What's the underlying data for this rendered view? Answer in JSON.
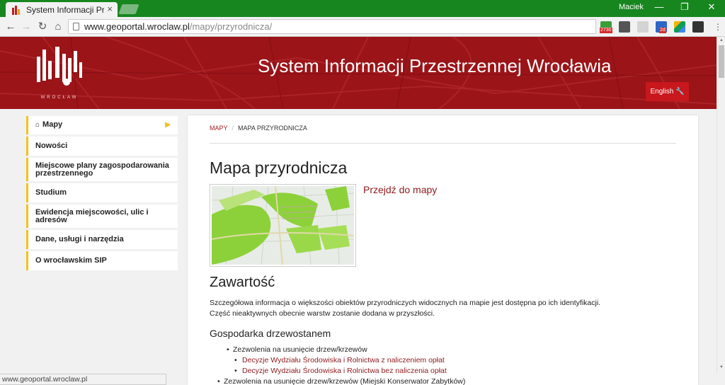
{
  "browser": {
    "tab_title": "System Informacji Przestrzennej Wrocławia",
    "tab_close": "×",
    "user_name": "Maciek",
    "window_minimize": "—",
    "window_restore": "❐",
    "window_close": "✕",
    "back": "←",
    "forward": "→",
    "reload": "↻",
    "home": "⌂",
    "url_domain": "www.geoportal.wroclaw.pl",
    "url_path": "/mapy/przyrodnicza/",
    "ext_badge_1": "2730",
    "ext_badge_2": "2d",
    "status_url": "www.geoportal.wroclaw.pl"
  },
  "banner": {
    "logo_text": "WROCŁAW",
    "site_title": "System Informacji Przestrzennej Wrocławia",
    "english_label": "English 🔧"
  },
  "sidebar": {
    "items": [
      {
        "label": "Mapy"
      },
      {
        "label": "Nowości"
      },
      {
        "label": "Miejscowe plany zagospodarowania przestrzennego"
      },
      {
        "label": "Studium"
      },
      {
        "label": "Ewidencja miejscowości, ulic i adresów"
      },
      {
        "label": "Dane, usługi i narzędzia"
      },
      {
        "label": "O wrocławskim SIP"
      }
    ]
  },
  "main": {
    "breadcrumb": {
      "link": "MAPY",
      "separator": "/",
      "current": "MAPA PRZYRODNICZA"
    },
    "title": "Mapa przyrodnicza",
    "go_to_map": "Przejdź do mapy",
    "section_heading": "Zawartość",
    "para_line1": "Szczegółowa informacja o większości obiektów przyrodniczych widocznych na mapie jest dostępna po ich identyfikacji.",
    "para_line2": "Część nieaktywnych obecnie warstw zostanie dodana w przyszłości.",
    "subheading": "Gospodarka drzewostanem",
    "list_item_1": "Zezwolenia na usunięcie drzew/krzewów",
    "list_sub_1": "Decyzje Wydziału Środowiska i Rolnictwa z naliczeniem opłat",
    "list_sub_2": "Decyzje Wydziału Środowiska i Rolnictwa bez naliczenia opłat",
    "list_item_2": "Zezwolenia na usunięcie drzew/krzewów (Miejski Konserwator Zabytków)"
  },
  "colors": {
    "brand_red": "#9b1418",
    "accent_yellow": "#f0c419",
    "link_red": "#8e1a1e",
    "chrome_green": "#17861f"
  }
}
